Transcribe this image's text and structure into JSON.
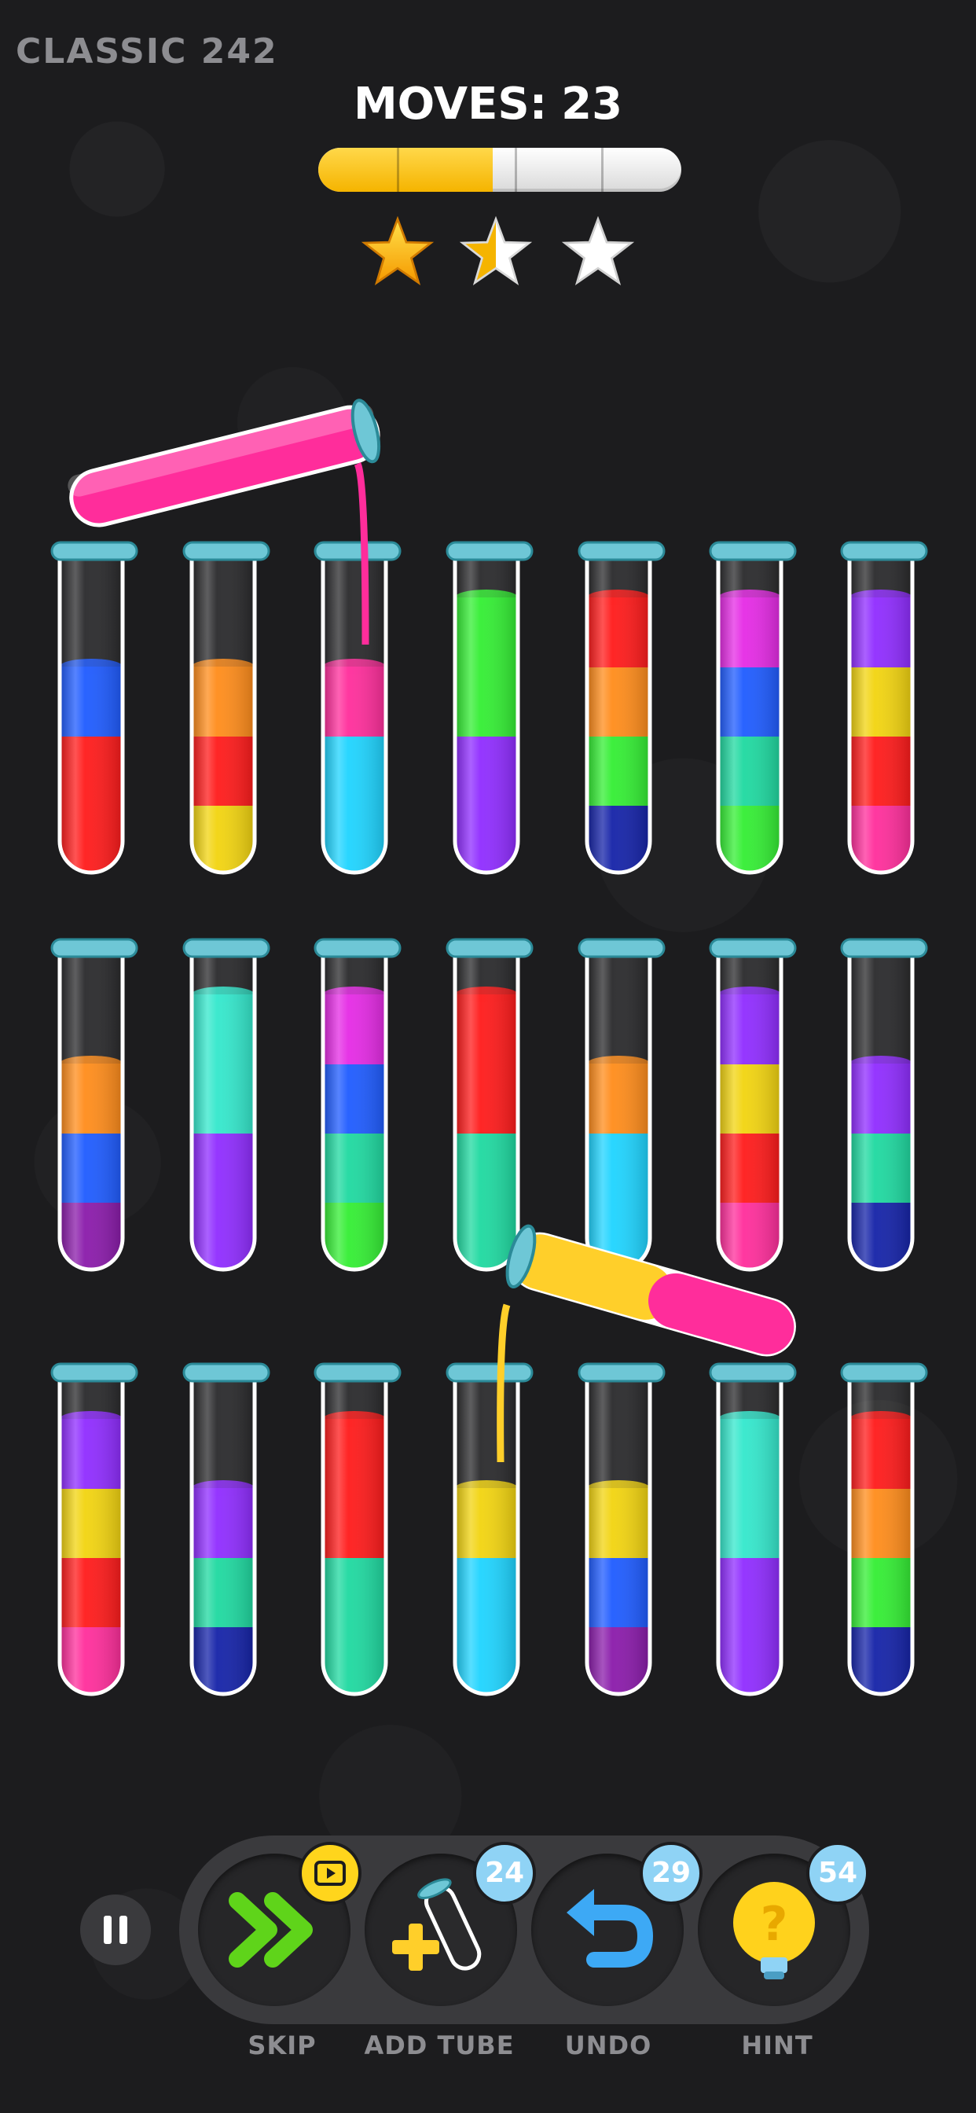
{
  "header": {
    "level_title": "CLASSIC 242",
    "moves_label": "MOVES:",
    "moves_count": "23"
  },
  "progress": {
    "fill_fraction": 0.48,
    "color": "#f5b400"
  },
  "stars": {
    "total": 3,
    "earned": 2,
    "partial_second": true
  },
  "colors": {
    "red": "#ff1a1a",
    "blue": "#1e5bff",
    "yellow": "#f2d40f",
    "orange": "#ff8c1a",
    "pink": "#ff2d9b",
    "cyan": "#1ed4ff",
    "green": "#33ee33",
    "purple": "#8f2cff",
    "magenta": "#e52ae5",
    "teal": "#1ed9a0",
    "navy": "#1422a8",
    "darkpurple": "#8a1aaa",
    "mint": "#33e8cc",
    "empty": "none"
  },
  "tubes": [
    {
      "row": 0,
      "col": 0,
      "layers": [
        "red",
        "red",
        "blue"
      ]
    },
    {
      "row": 0,
      "col": 1,
      "layers": [
        "yellow",
        "red",
        "orange"
      ]
    },
    {
      "row": 0,
      "col": 2,
      "layers": [
        "cyan",
        "cyan",
        "pink"
      ],
      "receiving": "pink"
    },
    {
      "row": 0,
      "col": 3,
      "layers": [
        "purple",
        "purple",
        "green",
        "green"
      ]
    },
    {
      "row": 0,
      "col": 4,
      "layers": [
        "navy",
        "green",
        "orange",
        "red"
      ]
    },
    {
      "row": 0,
      "col": 5,
      "layers": [
        "green",
        "teal",
        "blue",
        "magenta"
      ]
    },
    {
      "row": 0,
      "col": 6,
      "layers": [
        "pink",
        "red",
        "yellow",
        "purple"
      ]
    },
    {
      "row": 1,
      "col": 0,
      "layers": [
        "darkpurple",
        "blue",
        "orange"
      ]
    },
    {
      "row": 1,
      "col": 1,
      "layers": [
        "purple",
        "purple",
        "mint",
        "mint"
      ]
    },
    {
      "row": 1,
      "col": 2,
      "layers": [
        "green",
        "teal",
        "blue",
        "magenta"
      ]
    },
    {
      "row": 1,
      "col": 3,
      "layers": [
        "teal",
        "teal",
        "red",
        "red"
      ]
    },
    {
      "row": 1,
      "col": 4,
      "layers": [
        "cyan",
        "cyan",
        "orange"
      ]
    },
    {
      "row": 1,
      "col": 5,
      "layers": [
        "pink",
        "red",
        "yellow",
        "purple"
      ]
    },
    {
      "row": 1,
      "col": 6,
      "layers": [
        "navy",
        "teal",
        "purple"
      ]
    },
    {
      "row": 2,
      "col": 0,
      "layers": [
        "pink",
        "red",
        "yellow",
        "purple"
      ]
    },
    {
      "row": 2,
      "col": 1,
      "layers": [
        "navy",
        "teal",
        "purple"
      ]
    },
    {
      "row": 2,
      "col": 2,
      "layers": [
        "teal",
        "teal",
        "red",
        "red"
      ]
    },
    {
      "row": 2,
      "col": 3,
      "layers": [
        "cyan",
        "cyan",
        "yellow"
      ],
      "receiving": "yellow"
    },
    {
      "row": 2,
      "col": 4,
      "layers": [
        "darkpurple",
        "blue",
        "yellow"
      ]
    },
    {
      "row": 2,
      "col": 5,
      "layers": [
        "purple",
        "purple",
        "mint",
        "mint"
      ]
    },
    {
      "row": 2,
      "col": 6,
      "layers": [
        "navy",
        "green",
        "orange",
        "red"
      ]
    }
  ],
  "pouring_tubes": [
    {
      "name": "pouring-tube-pink",
      "color": "pink",
      "target": "row0-col2"
    },
    {
      "name": "pouring-tube-yellow-pink",
      "colors": [
        "yellow",
        "pink"
      ],
      "target": "row2-col3"
    }
  ],
  "controls": {
    "skip": {
      "label": "SKIP",
      "icon": "double-chevron-icon",
      "badge_icon": "video-icon"
    },
    "add_tube": {
      "label": "ADD TUBE",
      "icon": "add-tube-icon",
      "badge": "24"
    },
    "undo": {
      "label": "UNDO",
      "icon": "undo-arrow-icon",
      "badge": "29"
    },
    "hint": {
      "label": "HINT",
      "icon": "lightbulb-icon",
      "badge": "54"
    },
    "pause_icon": "pause-icon"
  }
}
